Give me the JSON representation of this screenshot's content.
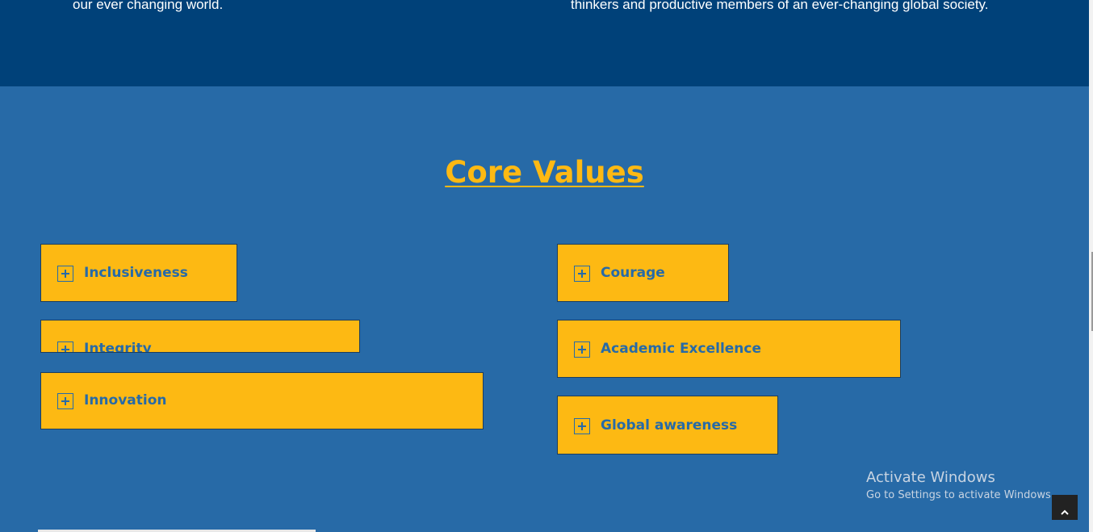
{
  "top_section": {
    "left_text": "our ever changing world.",
    "right_text": "thinkers and productive members of an ever-changing global society."
  },
  "core_values": {
    "title": "Core Values",
    "items": [
      {
        "label": "Inclusiveness",
        "icon": "plus-square-icon",
        "expanded": false
      },
      {
        "label": "Integrity",
        "icon": "plus-square-icon",
        "expanded": false
      },
      {
        "label": "Innovation",
        "icon": "plus-square-icon",
        "expanded": false
      },
      {
        "label": "Courage",
        "icon": "plus-square-icon",
        "expanded": false
      },
      {
        "label": "Academic Excellence",
        "icon": "plus-square-icon",
        "expanded": false
      },
      {
        "label": "Global awareness",
        "icon": "plus-square-icon",
        "expanded": false
      }
    ]
  },
  "watermark": {
    "line1": "Activate Windows",
    "line2": "Go to Settings to activate Windows."
  },
  "back_to_top": {
    "icon": "chevron-up-icon"
  },
  "colors": {
    "top_band": "#004179",
    "section_bg": "#276aa7",
    "accent": "#fdb913"
  }
}
